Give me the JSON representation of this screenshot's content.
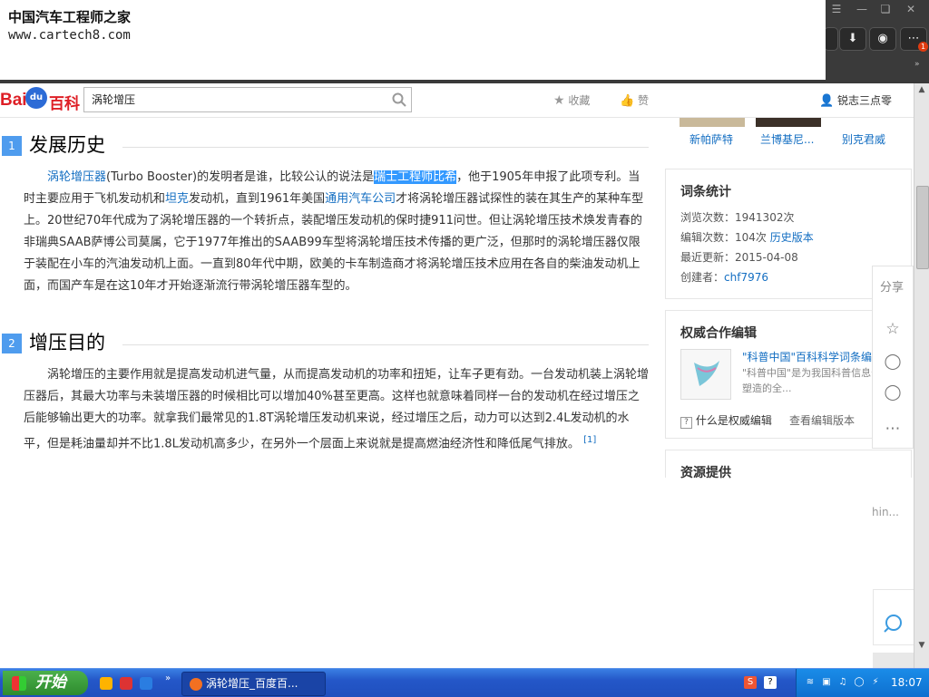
{
  "watermark": {
    "title": "中国汽车工程师之家",
    "url": "www.cartech8.com"
  },
  "header": {
    "logo": {
      "bai": "Bai",
      "paw": "du",
      "baike": "百科"
    },
    "search_value": "涡轮增压",
    "favorite_label": "收藏",
    "like_label": "赞",
    "user_name": "锐志三点零"
  },
  "sections": [
    {
      "number": "1",
      "title": "发展历史",
      "para_start": "",
      "link1": "涡轮增压器",
      "text1": "(Turbo Booster)的发明者是谁，比较公认的说法是",
      "highlight": "瑞士工程师比希",
      "text2": "，他于1905年申报了此项专利。当时主要应用于飞机发动机和",
      "link2": "坦克",
      "text3": "发动机，直到1961年美国",
      "link3": "通用汽车公司",
      "text4": "才将涡轮增压器试探性的装在其生产的某种车型上。20世纪70年代成为了涡轮增压器的一个转折点，装配增压发动机的保时捷911问世。但让涡轮增压技术焕发青春的非瑞典SAAB萨博公司莫属，它于1977年推出的SAAB99车型将涡轮增压技术传播的更广泛，但那时的涡轮增压器仅限于装配在小车的汽油发动机上面。一直到80年代中期，欧美的卡车制造商才将涡轮增压技术应用在各自的柴油发动机上面，而国产车是在这10年才开始逐渐流行带涡轮增压器车型的。"
    },
    {
      "number": "2",
      "title": "增压目的",
      "text": "涡轮增压的主要作用就是提高发动机进气量，从而提高发动机的功率和扭矩，让车子更有劲。一台发动机装上涡轮增压器后，其最大功率与未装增压器的时候相比可以增加40%甚至更高。这样也就意味着同样一台的发动机在经过增压之后能够输出更大的功率。就拿我们最常见的1.8T涡轮增压发动机来说，经过增压之后，动力可以达到2.4L发动机的水平，但是耗油量却并不比1.8L发动机高多少，在另外一个层面上来说就是提高燃油经济性和降低尾气排放。",
      "ref": "[1]"
    }
  ],
  "sidebar": {
    "related": [
      "新帕萨特",
      "兰博基尼...",
      "别克君威"
    ],
    "stats": {
      "title": "词条统计",
      "views_label": "浏览次数：",
      "views": "1941302次",
      "edits_label": "编辑次数：",
      "edits": "104次",
      "history_link": "历史版本",
      "updated_label": "最近更新：",
      "updated": "2015-04-08",
      "creator_label": "创建者：",
      "creator": "chf7976"
    },
    "authority": {
      "title": "权威合作编辑",
      "partner_name": "\"科普中国\"百科科学词条编",
      "partner_desc": "\"科普中国\"是为我国科普信息化建设塑造的全...",
      "what_link": "什么是权威编辑",
      "view_link": "查看编辑版本"
    },
    "resources": {
      "title": "资源提供",
      "partial_text": "hin..."
    },
    "share_label": "分享"
  },
  "taskbar": {
    "start_label": "开始",
    "task_item": "涡轮增压_百度百...",
    "clock": "18:07"
  }
}
